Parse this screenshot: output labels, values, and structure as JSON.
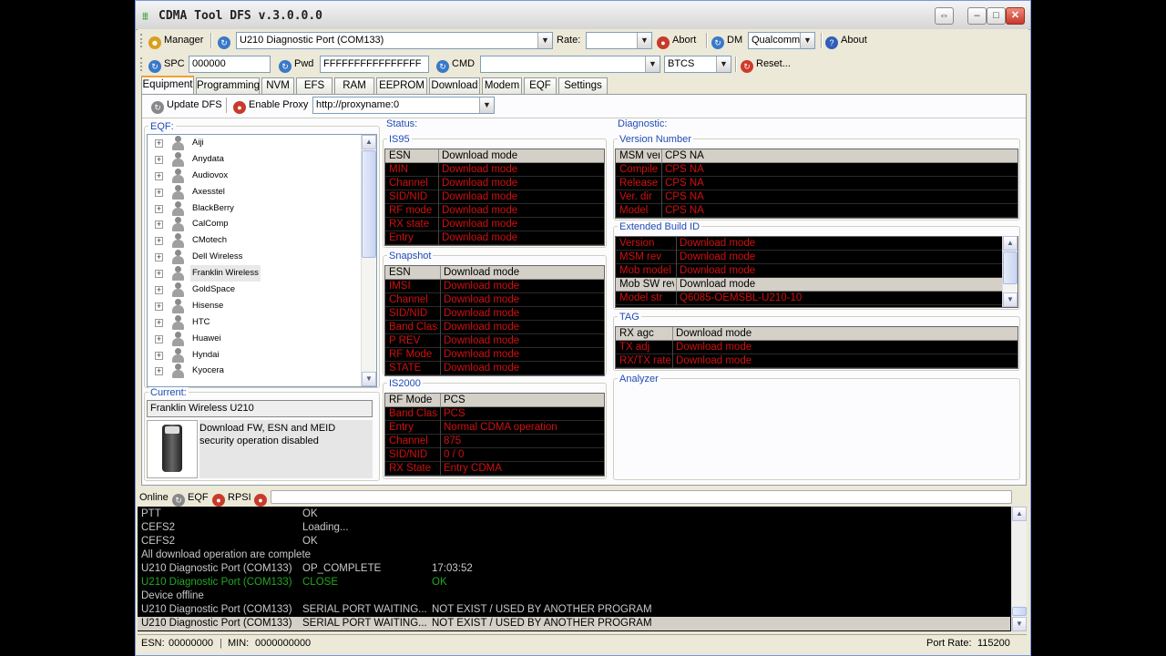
{
  "window": {
    "title": "CDMA Tool DFS v.3.0.0.0"
  },
  "toolbar1": {
    "manager": "Manager",
    "port": "U210 Diagnostic Port (COM133)",
    "rate_label": "Rate:",
    "rate_value": "",
    "abort": "Abort",
    "dm": "DM",
    "dm_value": "Qualcomm",
    "about": "About"
  },
  "toolbar2": {
    "spc": "SPC",
    "spc_value": "000000",
    "pwd": "Pwd",
    "pwd_value": "FFFFFFFFFFFFFFFF",
    "cmd": "CMD",
    "cmd_value": "",
    "mode_value": "BTCS",
    "reset": "Reset..."
  },
  "tabs": [
    "Equipment",
    "Programming",
    "NVM",
    "EFS",
    "RAM",
    "EEPROM",
    "Download",
    "Modem",
    "EQF",
    "Settings"
  ],
  "subtoolbar": {
    "update": "Update DFS",
    "proxy": "Enable Proxy",
    "proxy_value": "http://proxyname:0"
  },
  "eqf": {
    "label": "EQF:",
    "items": [
      "Aiji",
      "Anydata",
      "Audiovox",
      "Axesstel",
      "BlackBerry",
      "CalComp",
      "CMotech",
      "Dell Wireless",
      "Franklin Wireless",
      "GoldSpace",
      "Hisense",
      "HTC",
      "Huawei",
      "Hyndai",
      "Kyocera"
    ],
    "selected": "Franklin Wireless"
  },
  "current": {
    "label": "Current:",
    "device": "Franklin Wireless U210",
    "desc": "Download FW, ESN and MEID security operation disabled"
  },
  "status": {
    "label": "Status:",
    "is95_label": "IS95",
    "is95": [
      [
        "ESN",
        "Download mode"
      ],
      [
        "MIN",
        "Download mode"
      ],
      [
        "Channel",
        "Download mode"
      ],
      [
        "SID/NID",
        "Download mode"
      ],
      [
        "RF mode",
        "Download mode"
      ],
      [
        "RX state",
        "Download mode"
      ],
      [
        "Entry",
        "Download mode"
      ]
    ],
    "snapshot_label": "Snapshot",
    "snapshot": [
      [
        "ESN",
        "Download mode"
      ],
      [
        "IMSI",
        "Download mode"
      ],
      [
        "Channel",
        "Download mode"
      ],
      [
        "SID/NID",
        "Download mode"
      ],
      [
        "Band Class",
        "Download mode"
      ],
      [
        "P REV",
        "Download mode"
      ],
      [
        "RF Mode",
        "Download mode"
      ],
      [
        "STATE",
        "Download mode"
      ]
    ],
    "is2000_label": "IS2000",
    "is2000": [
      [
        "RF Mode",
        "PCS"
      ],
      [
        "Band Class",
        "PCS"
      ],
      [
        "Entry",
        "Normal CDMA operation"
      ],
      [
        "Channel",
        "875"
      ],
      [
        "SID/NID",
        "0 / 0"
      ],
      [
        "RX State",
        "Entry CDMA"
      ]
    ]
  },
  "diagnostic": {
    "label": "Diagnostic:",
    "version_label": "Version Number",
    "version": [
      [
        "MSM ver",
        "CPS  NA"
      ],
      [
        "Compile",
        "CPS  NA"
      ],
      [
        "Release",
        "CPS  NA"
      ],
      [
        "Ver. dir",
        "CPS  NA"
      ],
      [
        "Model",
        "CPS  NA"
      ]
    ],
    "build_label": "Extended Build ID",
    "build": [
      [
        "Version",
        "Download mode"
      ],
      [
        "MSM rev",
        "Download mode"
      ],
      [
        "Mob model",
        "Download mode"
      ],
      [
        "Mob SW rev",
        "Download mode"
      ],
      [
        "Model str",
        "Q6085-OEMSBL-U210-10"
      ]
    ],
    "tag_label": "TAG",
    "tag": [
      [
        "RX agc",
        "Download mode"
      ],
      [
        "TX adj",
        "Download mode"
      ],
      [
        "RX/TX rate",
        "Download mode"
      ]
    ],
    "analyzer_label": "Analyzer"
  },
  "statusline": {
    "online": "Online",
    "eqf": "EQF",
    "rpsi": "RPSI"
  },
  "log": [
    [
      "PTT",
      "OK",
      "",
      "#c8c8c8"
    ],
    [
      "CEFS2",
      "Loading...",
      "",
      "#c8c8c8"
    ],
    [
      "CEFS2",
      "OK",
      "",
      "#c8c8c8"
    ],
    [
      "All download operation are complete",
      "",
      "",
      "#c8c8c8"
    ],
    [
      "U210 Diagnostic Port (COM133)",
      "OP_COMPLETE",
      "17:03:52",
      "#c8c8c8"
    ],
    [
      "U210 Diagnostic Port (COM133)",
      "CLOSE",
      "OK",
      "#22a822"
    ],
    [
      "Device offline",
      "",
      "",
      "#c8c8c8"
    ],
    [
      "U210 Diagnostic Port (COM133)",
      "SERIAL PORT WAITING...",
      "NOT EXIST / USED BY ANOTHER PROGRAM",
      "#c8c8c8"
    ],
    [
      "U210 Diagnostic Port (COM133)",
      "SERIAL PORT WAITING...",
      "NOT EXIST / USED BY ANOTHER PROGRAM",
      "#c8c8c8"
    ]
  ],
  "footer": {
    "esn_label": "ESN:",
    "esn": "00000000",
    "min_label": "MIN:",
    "min": "0000000000",
    "port_rate_label": "Port Rate:",
    "port_rate": "115200"
  }
}
